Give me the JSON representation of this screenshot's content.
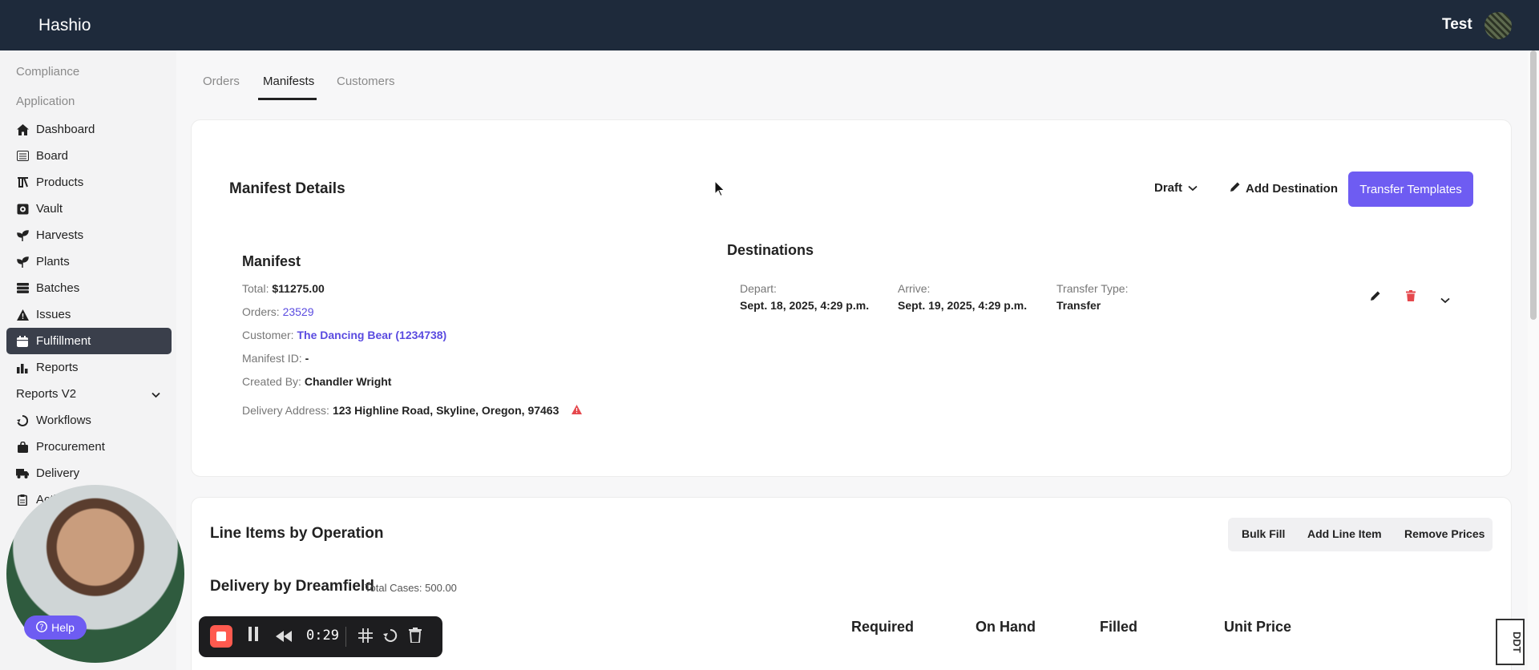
{
  "app": {
    "brand": "Hashio",
    "user_name": "Test"
  },
  "sidebar": {
    "sections": [
      "Compliance",
      "Application"
    ],
    "items": [
      {
        "label": "Dashboard",
        "icon": "home-icon"
      },
      {
        "label": "Board",
        "icon": "board-icon"
      },
      {
        "label": "Products",
        "icon": "flask-icon"
      },
      {
        "label": "Vault",
        "icon": "vault-icon"
      },
      {
        "label": "Harvests",
        "icon": "sprout-icon"
      },
      {
        "label": "Plants",
        "icon": "sprout-icon"
      },
      {
        "label": "Batches",
        "icon": "batches-icon"
      },
      {
        "label": "Issues",
        "icon": "warning-icon"
      },
      {
        "label": "Fulfillment",
        "icon": "calendar-icon"
      },
      {
        "label": "Reports",
        "icon": "bar-chart-icon"
      },
      {
        "label": "Reports V2",
        "icon": "chevron-down-icon"
      },
      {
        "label": "Workflows",
        "icon": "recycle-icon"
      },
      {
        "label": "Procurement",
        "icon": "bag-icon"
      },
      {
        "label": "Delivery",
        "icon": "truck-icon"
      },
      {
        "label": "Acti",
        "icon": "clipboard-icon"
      }
    ]
  },
  "tabs": [
    "Orders",
    "Manifests",
    "Customers"
  ],
  "manifest_details": {
    "title": "Manifest Details",
    "status": "Draft",
    "add_destination": "Add Destination",
    "transfer_templates": "Transfer Templates"
  },
  "manifest": {
    "heading": "Manifest",
    "total_label": "Total:",
    "total_value": "$11275.00",
    "orders_label": "Orders:",
    "orders_value": "23529",
    "customer_label": "Customer:",
    "customer_value": "The Dancing Bear (1234738)",
    "manifest_id_label": "Manifest ID:",
    "manifest_id_value": "-",
    "created_by_label": "Created By:",
    "created_by_value": "Chandler Wright",
    "delivery_address_label": "Delivery Address:",
    "delivery_address_value": "123 Highline Road, Skyline, Oregon, 97463"
  },
  "destinations": {
    "heading": "Destinations",
    "depart_label": "Depart:",
    "depart_value": "Sept. 18, 2025, 4:29 p.m.",
    "arrive_label": "Arrive:",
    "arrive_value": "Sept. 19, 2025, 4:29 p.m.",
    "transfer_type_label": "Transfer Type:",
    "transfer_type_value": "Transfer"
  },
  "line_items": {
    "title": "Line Items by Operation",
    "buttons": [
      "Bulk Fill",
      "Add Line Item",
      "Remove Prices"
    ],
    "operation_title": "Delivery by Dreamfield",
    "total_cases": "Total Cases: 500.00",
    "columns": [
      "Required",
      "On Hand",
      "Filled",
      "Unit Price"
    ]
  },
  "overlay": {
    "help_label": "Help",
    "recording_time": "0:29",
    "watermark": "DDT"
  },
  "colors": {
    "topbar": "#1e2a3b",
    "accent": "#6e5cf2",
    "active_nav": "#3a3f4b",
    "danger": "#e5484d"
  }
}
